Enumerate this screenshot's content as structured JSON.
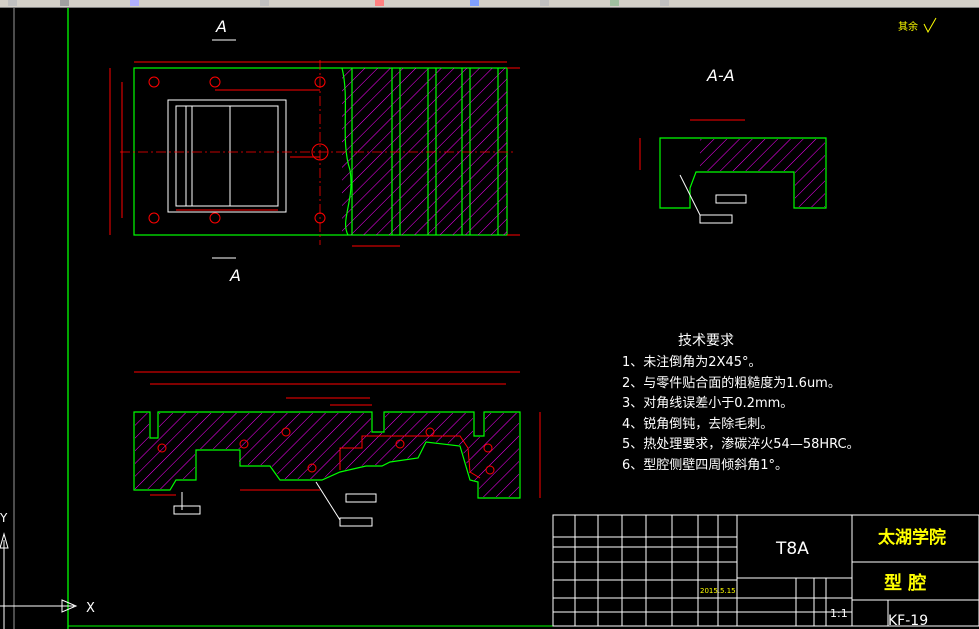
{
  "view_labels": {
    "section_a_top": "A",
    "section_a_bottom": "A",
    "section_title": "A-A",
    "roughness_rest": "其余"
  },
  "tech_requirements": {
    "title": "技术要求",
    "items": [
      "1、未注倒角为2X45°。",
      "2、与零件贴合面的粗糙度为1.6um。",
      "3、对角线误差小于0.2mm。",
      "4、锐角倒钝，去除毛刺。",
      "5、热处理要求，渗碳淬火54—58HRC。",
      "6、型腔侧壁四周倾斜角1°。"
    ]
  },
  "title_block": {
    "material": "T8A",
    "school": "太湖学院",
    "part_name": "型 腔",
    "drawing_no": "KF-19",
    "scale": "1:1",
    "date": "2015.5.15"
  },
  "ucs_icon": {
    "x_label": "X",
    "y_label": "Y"
  },
  "colors": {
    "background": "#000000",
    "part_outline": "#00ff00",
    "dimension": "#ff0000",
    "hatch": "#ff00ff",
    "text": "#ffffff",
    "annotation": "#ffff00"
  }
}
